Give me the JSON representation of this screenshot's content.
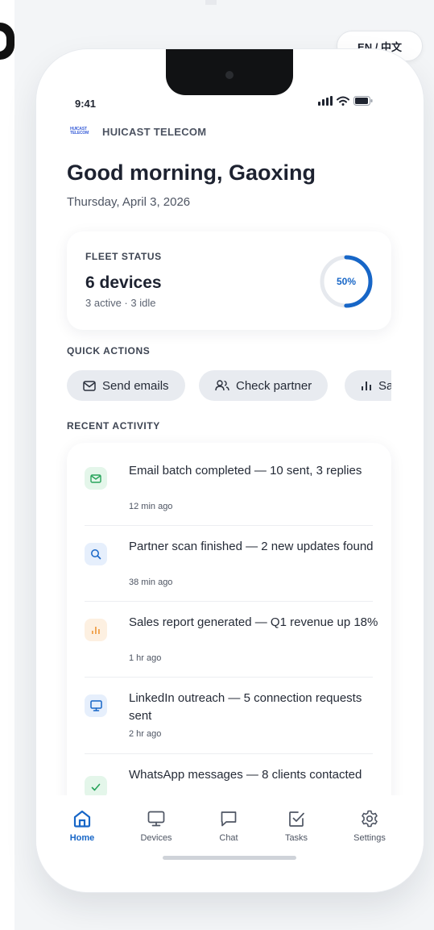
{
  "language_toggle": "EN / 中文",
  "status_bar": {
    "time": "9:41"
  },
  "brand": {
    "logo_text_line1": "HUICAST",
    "logo_text_line2": "TELECOM",
    "name": "HUICAST TELECOM"
  },
  "greeting": "Good morning, Gaoxing",
  "date": "Thursday, April 3, 2026",
  "fleet": {
    "label": "FLEET STATUS",
    "count": "6 devices",
    "sub": "3 active · 3 idle",
    "percent_label": "50%",
    "percent_value": 0.5,
    "ring_color": "#1766c7"
  },
  "quick_actions": {
    "label": "QUICK ACTIONS",
    "items": [
      {
        "label": "Send emails",
        "icon": "mail-icon"
      },
      {
        "label": "Check partner",
        "icon": "users-icon"
      },
      {
        "label": "Sa",
        "icon": "bar-chart-icon"
      }
    ]
  },
  "recent_activity": {
    "label": "RECENT ACTIVITY",
    "items": [
      {
        "title": "Email batch completed — 10 sent, 3 replies",
        "time": "12 min ago",
        "icon": "mail-icon",
        "color": "#27a35a",
        "bg": "#e4f6ea"
      },
      {
        "title": "Partner scan finished — 2 new updates found",
        "time": "38 min ago",
        "icon": "search-icon",
        "color": "#1766c7",
        "bg": "#e6effc"
      },
      {
        "title": "Sales report generated — Q1 revenue up 18%",
        "time": "1 hr ago",
        "icon": "bar-chart-icon",
        "color": "#f0a04b",
        "bg": "#fdf0e1"
      },
      {
        "title": "LinkedIn outreach — 5 connection requests sent",
        "time": "2 hr ago",
        "icon": "monitor-icon",
        "color": "#1766c7",
        "bg": "#e6effc"
      },
      {
        "title": "WhatsApp messages — 8 clients contacted",
        "time": "",
        "icon": "check-icon",
        "color": "#27a35a",
        "bg": "#e4f6ea"
      }
    ]
  },
  "tabs": [
    {
      "label": "Home",
      "icon": "home-icon",
      "active": true
    },
    {
      "label": "Devices",
      "icon": "monitor-icon"
    },
    {
      "label": "Chat",
      "icon": "chat-icon"
    },
    {
      "label": "Tasks",
      "icon": "tasks-icon"
    },
    {
      "label": "Settings",
      "icon": "gear-icon"
    }
  ]
}
